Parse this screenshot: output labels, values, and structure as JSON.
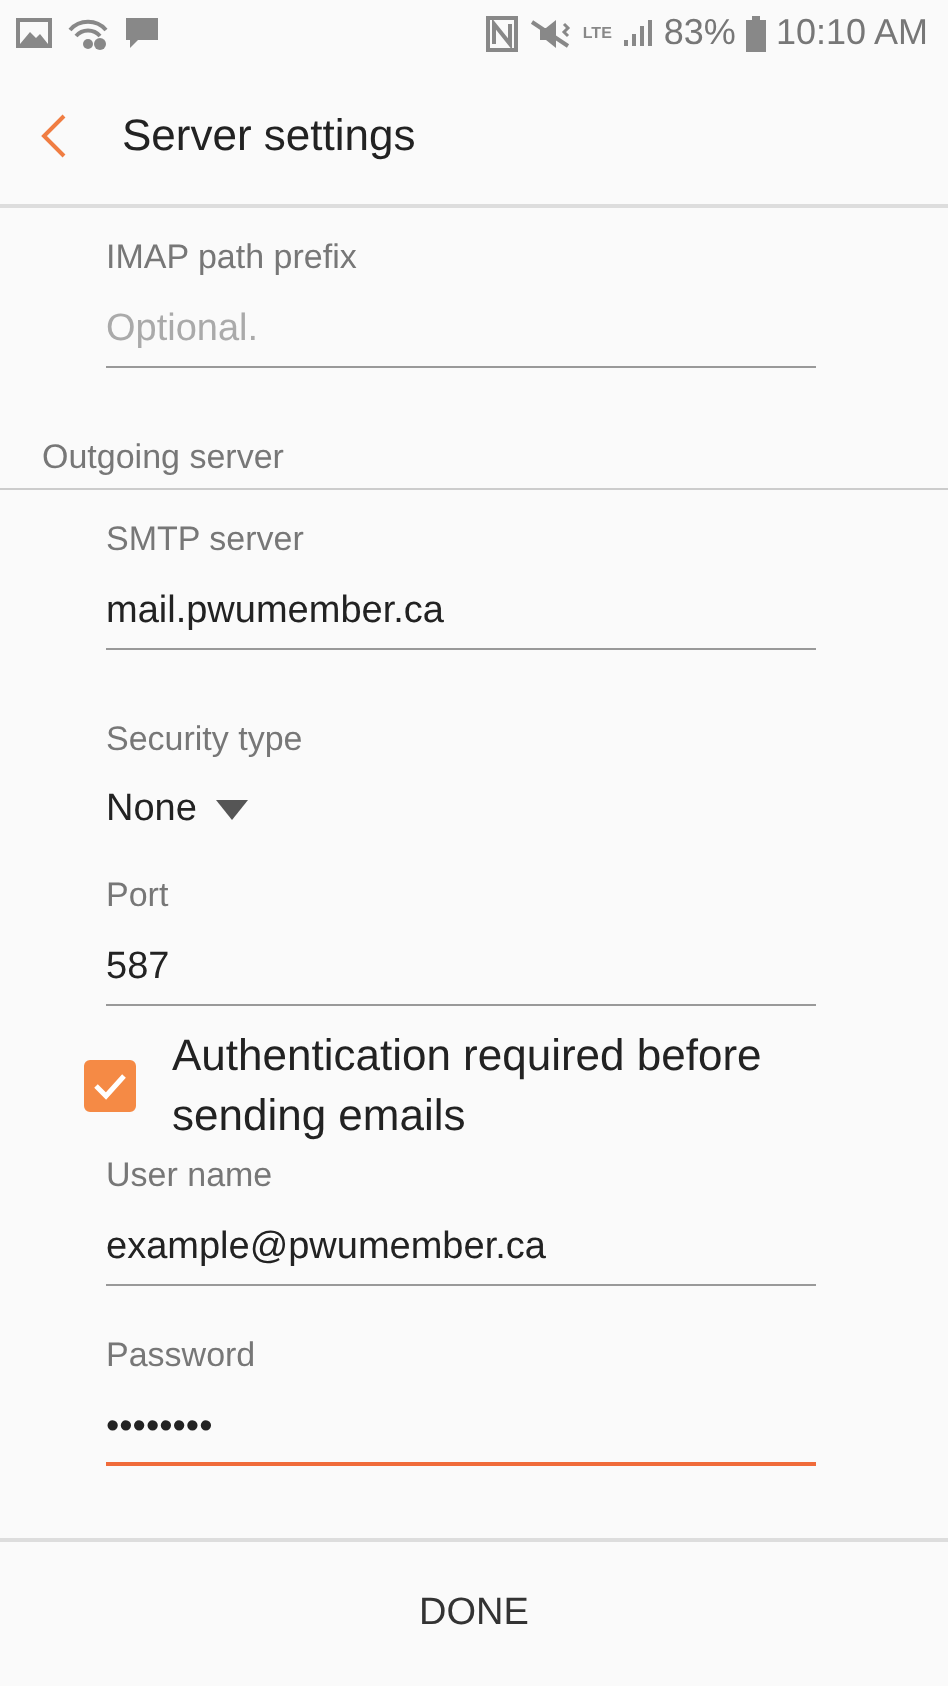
{
  "status_bar": {
    "network_type": "LTE",
    "battery": "83%",
    "time": "10:10 AM"
  },
  "toolbar": {
    "title": "Server settings"
  },
  "items": [
    {
      "kind": "field",
      "label": "IMAP path prefix",
      "placeholder": "Optional.",
      "focused": false
    },
    {
      "kind": "section",
      "label": "Outgoing server"
    },
    {
      "kind": "field",
      "label": "SMTP server",
      "value": "mail.pwumember.ca",
      "focused": false
    },
    {
      "kind": "dropdown",
      "label": "Security type",
      "value": "None"
    },
    {
      "kind": "field",
      "label": "Port",
      "value": "587",
      "focused": false
    },
    {
      "kind": "checkbox",
      "label": "Authentication required before sending emails",
      "checked": true
    },
    {
      "kind": "field",
      "label": "User name",
      "value": "example@pwumember.ca",
      "focused": false
    },
    {
      "kind": "field",
      "label": "Password",
      "value": "••••••••",
      "focused": true
    }
  ],
  "bottom_button": "DONE"
}
